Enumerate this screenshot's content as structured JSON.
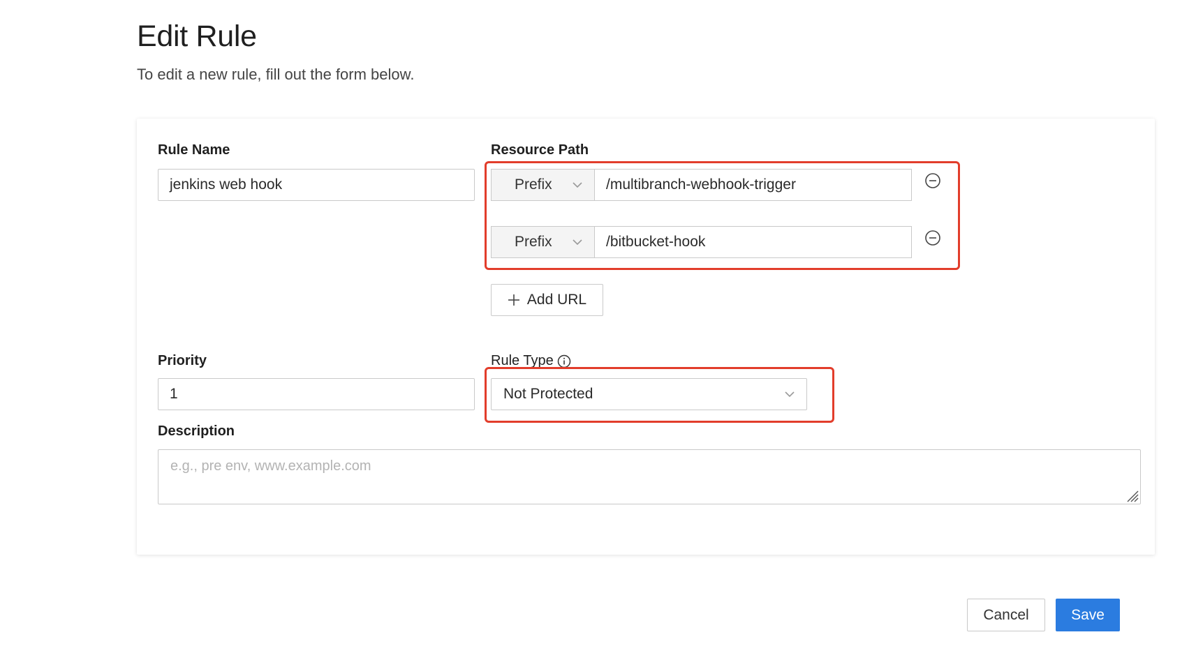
{
  "header": {
    "title": "Edit Rule",
    "subtitle": "To edit a new rule, fill out the form below."
  },
  "form": {
    "rule_name": {
      "label": "Rule Name",
      "value": "jenkins web hook"
    },
    "resource_path": {
      "label": "Resource Path",
      "rows": [
        {
          "match_type": "Prefix",
          "path": "/multibranch-webhook-trigger"
        },
        {
          "match_type": "Prefix",
          "path": "/bitbucket-hook"
        }
      ],
      "add_label": "Add URL"
    },
    "priority": {
      "label": "Priority",
      "value": "1"
    },
    "rule_type": {
      "label": "Rule Type",
      "value": "Not Protected"
    },
    "description": {
      "label": "Description",
      "placeholder": "e.g., pre env, www.example.com"
    }
  },
  "actions": {
    "cancel_label": "Cancel",
    "save_label": "Save"
  },
  "colors": {
    "accent": "#2b7ce0",
    "highlight": "#e23d2b"
  }
}
